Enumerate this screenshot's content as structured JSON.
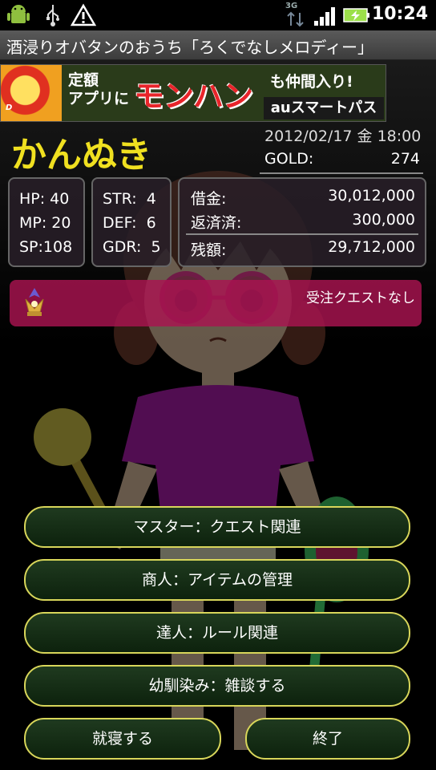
{
  "status_bar": {
    "network": "3G",
    "time": "10:24"
  },
  "titlebar": {
    "title": "酒浸りオバタンのおうち「ろくでなしメロディー」"
  },
  "ad": {
    "logo_text": "D",
    "line1": "定額",
    "line2": "アプリに",
    "highlight": "モンハン",
    "tail": "も仲間入り!",
    "service": "auスマートパス"
  },
  "character": {
    "name": "かんぬき"
  },
  "datetime": "2012/02/17 金 18:00",
  "gold": {
    "label": "GOLD:",
    "value": "274"
  },
  "stats": {
    "hp": "HP: 40",
    "mp": "MP: 20",
    "sp": "SP:108",
    "str": "STR:  4",
    "def": "DEF:  6",
    "gdr": "GDR:  5"
  },
  "finance": {
    "debt_label": "借金:",
    "debt_value": "30,012,000",
    "repaid_label": "返済済:",
    "repaid_value": "300,000",
    "balance_label": "残額:",
    "balance_value": "29,712,000"
  },
  "quest": {
    "text": "受注クエストなし"
  },
  "menu": {
    "master": "マスター：クエスト関連",
    "merchant": "商人：アイテムの管理",
    "expert": "達人：ルール関連",
    "friend": "幼馴染み：雑談する",
    "sleep": "就寝する",
    "quit": "終了"
  }
}
